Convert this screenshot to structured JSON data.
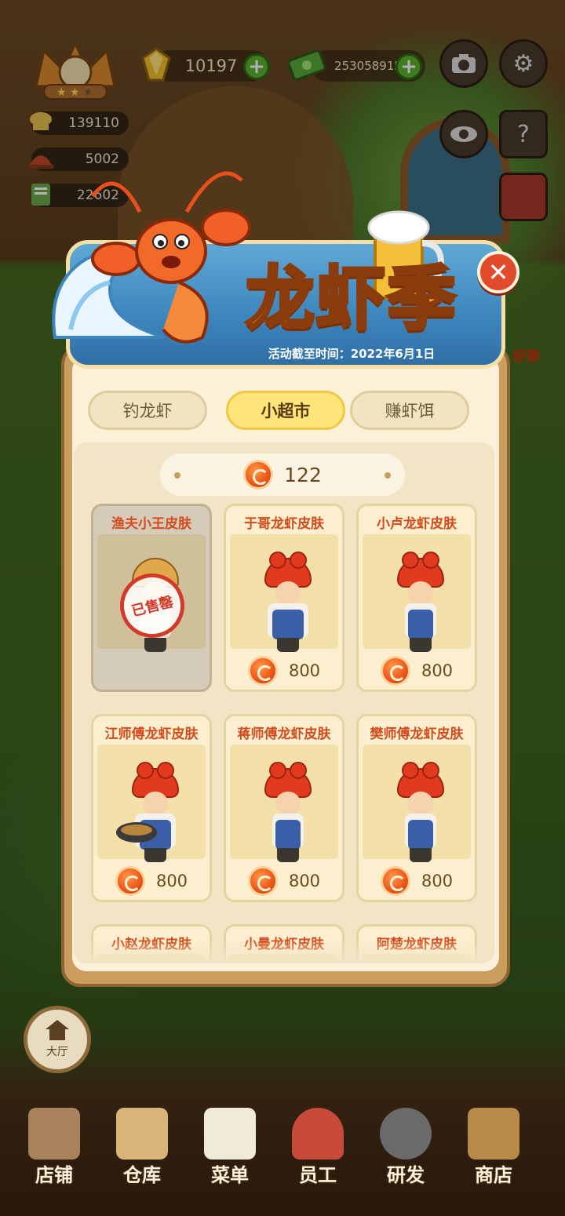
{
  "hud": {
    "gems": "10197",
    "cash": "253058915",
    "stats": [
      "139110",
      "5002",
      "22602"
    ]
  },
  "event": {
    "title": "龙虾季",
    "deadline": "活动截至时间：2022年6月1日",
    "side_badge": "虾季"
  },
  "tabs": [
    {
      "label": "钓龙虾",
      "active": false
    },
    {
      "label": "小超市",
      "active": true
    },
    {
      "label": "赚虾饵",
      "active": false
    }
  ],
  "shop": {
    "balance": "122",
    "items": [
      {
        "name": "渔夫小王皮肤",
        "price": "",
        "sold": true,
        "sold_label": "已售罄"
      },
      {
        "name": "于哥龙虾皮肤",
        "price": "800"
      },
      {
        "name": "小卢龙虾皮肤",
        "price": "800"
      },
      {
        "name": "江师傅龙虾皮肤",
        "price": "800"
      },
      {
        "name": "蒋师傅龙虾皮肤",
        "price": "800"
      },
      {
        "name": "樊师傅龙虾皮肤",
        "price": "800"
      },
      {
        "name": "小赵龙虾皮肤",
        "price": ""
      },
      {
        "name": "小曼龙虾皮肤",
        "price": ""
      },
      {
        "name": "阿楚龙虾皮肤",
        "price": ""
      }
    ]
  },
  "hall_button": "大厅",
  "nav": [
    {
      "label": "店铺",
      "icon": "shop-icon"
    },
    {
      "label": "仓库",
      "icon": "warehouse-icon"
    },
    {
      "label": "菜单",
      "icon": "menu-icon"
    },
    {
      "label": "员工",
      "icon": "staff-icon"
    },
    {
      "label": "研发",
      "icon": "research-icon"
    },
    {
      "label": "商店",
      "icon": "store-icon"
    }
  ],
  "colors": {
    "accent_red": "#d44a1c",
    "coin_orange": "#ef5a1a",
    "panel": "#fbf1d8",
    "tab_active": "#ffe57a"
  }
}
